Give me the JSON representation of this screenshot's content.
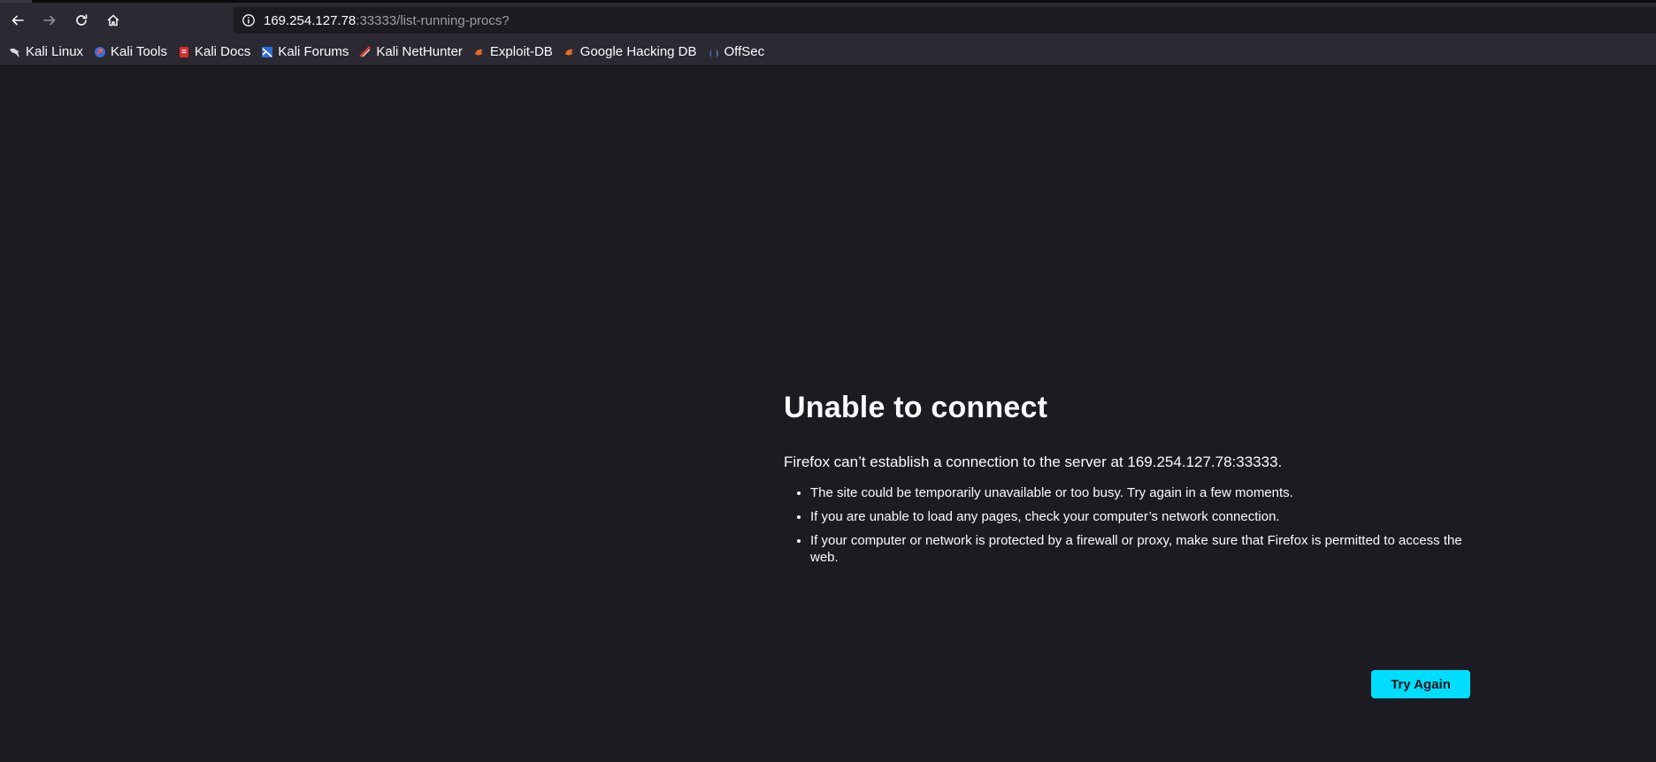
{
  "toolbar": {
    "back_icon": "back-arrow-icon",
    "forward_icon": "forward-arrow-icon",
    "reload_icon": "reload-icon",
    "home_icon": "home-icon"
  },
  "urlbar": {
    "host": "169.254.127.78",
    "rest": ":33333/list-running-procs?"
  },
  "bookmarks": [
    {
      "label": "Kali Linux",
      "icon": "kali-dragon-icon"
    },
    {
      "label": "Kali Tools",
      "icon": "kali-tools-icon"
    },
    {
      "label": "Kali Docs",
      "icon": "kali-docs-icon"
    },
    {
      "label": "Kali Forums",
      "icon": "kali-forums-icon"
    },
    {
      "label": "Kali NetHunter",
      "icon": "kali-nethunter-icon"
    },
    {
      "label": "Exploit-DB",
      "icon": "exploit-db-icon"
    },
    {
      "label": "Google Hacking DB",
      "icon": "ghdb-icon"
    },
    {
      "label": "OffSec",
      "icon": "offsec-icon"
    }
  ],
  "error": {
    "title": "Unable to connect",
    "description": "Firefox can’t establish a connection to the server at 169.254.127.78:33333.",
    "bullets": [
      "The site could be temporarily unavailable or too busy. Try again in a few moments.",
      "If you are unable to load any pages, check your computer’s network connection.",
      "If your computer or network is protected by a firewall or proxy, make sure that Firefox is permitted to access the web."
    ],
    "button_label": "Try Again"
  },
  "colors": {
    "page_bg": "#1c1b22",
    "toolbar_bg": "#2b2a33",
    "accent": "#00ddff"
  }
}
